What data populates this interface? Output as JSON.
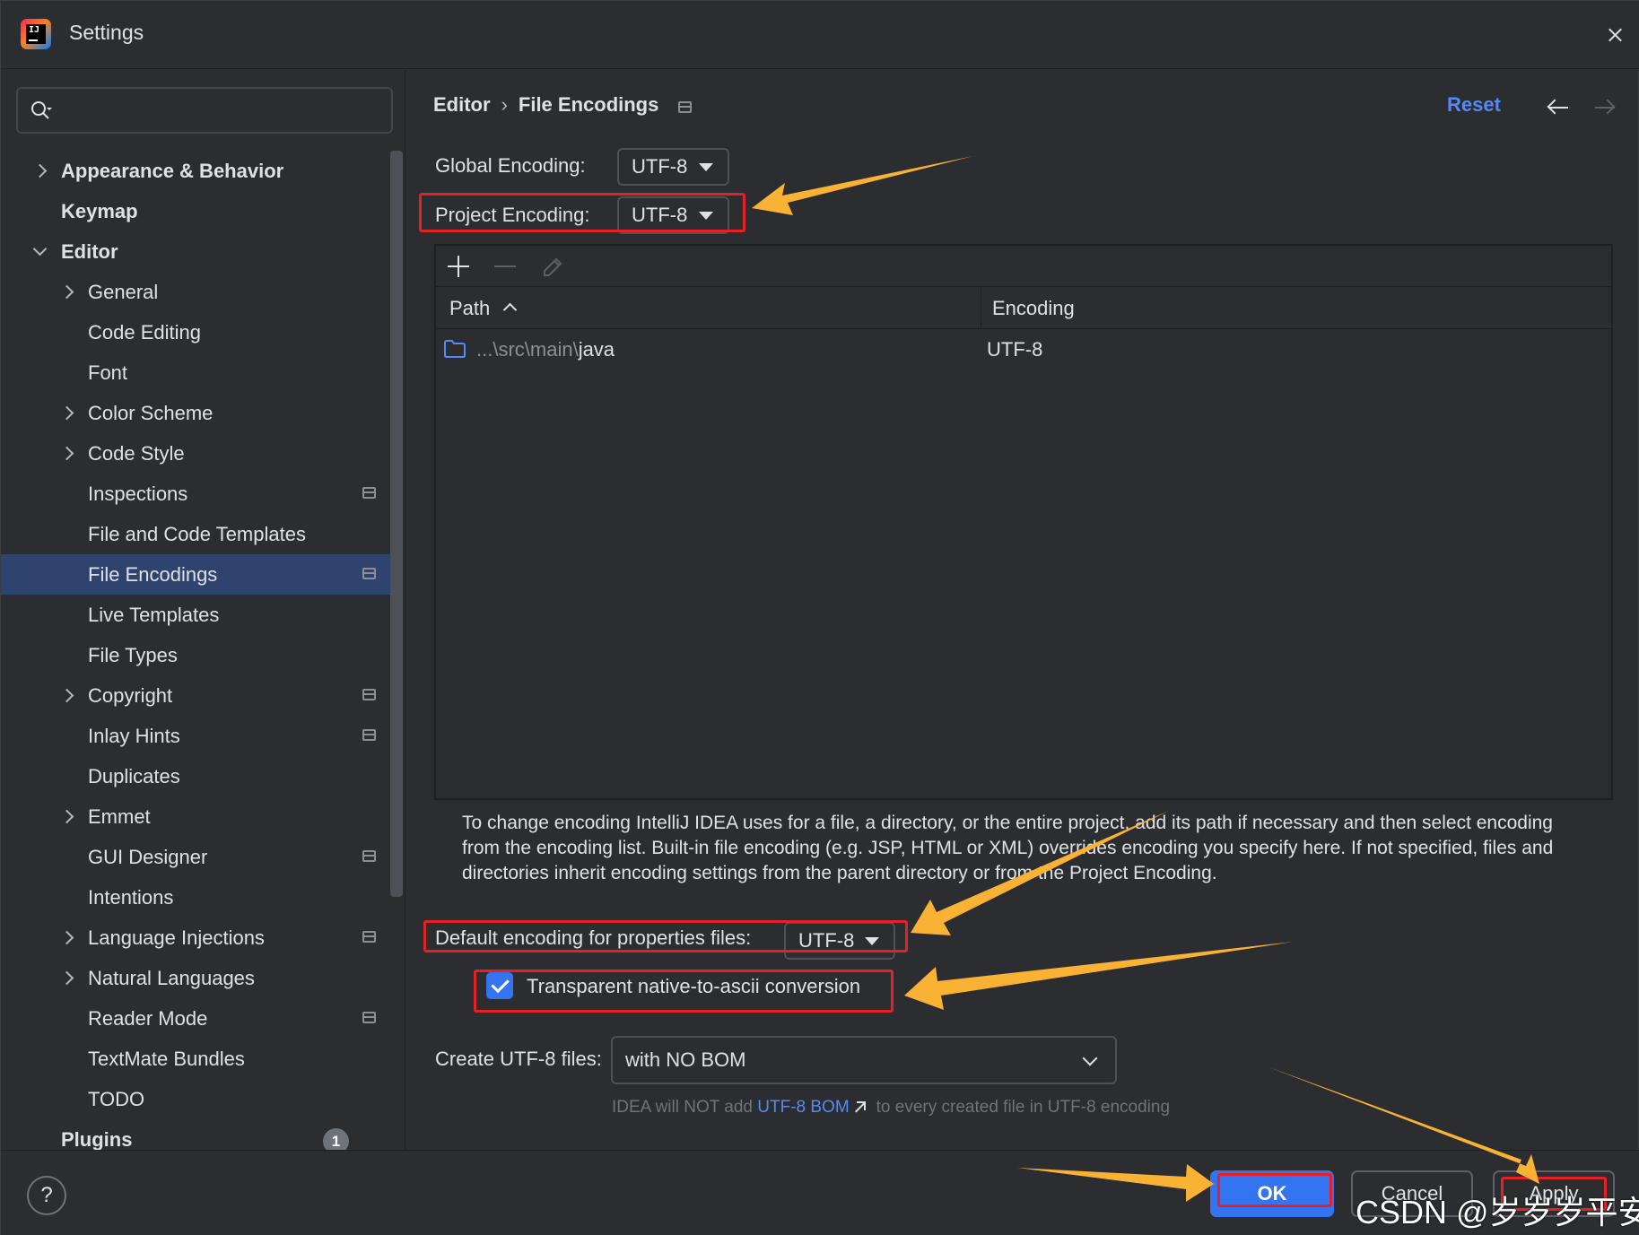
{
  "window": {
    "title": "Settings",
    "logo_text": "IJ"
  },
  "search": {
    "placeholder": "",
    "value": ""
  },
  "tree": [
    {
      "label": "Appearance & Behavior",
      "level": 0,
      "chevron": "closed",
      "bold": true,
      "project_icon": false
    },
    {
      "label": "Keymap",
      "level": 0,
      "chevron": "none",
      "bold": true,
      "project_icon": false
    },
    {
      "label": "Editor",
      "level": 0,
      "chevron": "open",
      "bold": true,
      "project_icon": false
    },
    {
      "label": "General",
      "level": 1,
      "chevron": "closed",
      "project_icon": false
    },
    {
      "label": "Code Editing",
      "level": 1,
      "chevron": "none",
      "project_icon": false
    },
    {
      "label": "Font",
      "level": 1,
      "chevron": "none",
      "project_icon": false
    },
    {
      "label": "Color Scheme",
      "level": 1,
      "chevron": "closed",
      "project_icon": false
    },
    {
      "label": "Code Style",
      "level": 1,
      "chevron": "closed",
      "project_icon": false
    },
    {
      "label": "Inspections",
      "level": 1,
      "chevron": "none",
      "project_icon": true
    },
    {
      "label": "File and Code Templates",
      "level": 1,
      "chevron": "none",
      "project_icon": false
    },
    {
      "label": "File Encodings",
      "level": 1,
      "chevron": "none",
      "project_icon": true,
      "selected": true
    },
    {
      "label": "Live Templates",
      "level": 1,
      "chevron": "none",
      "project_icon": false
    },
    {
      "label": "File Types",
      "level": 1,
      "chevron": "none",
      "project_icon": false
    },
    {
      "label": "Copyright",
      "level": 1,
      "chevron": "closed",
      "project_icon": true
    },
    {
      "label": "Inlay Hints",
      "level": 1,
      "chevron": "none",
      "project_icon": true
    },
    {
      "label": "Duplicates",
      "level": 1,
      "chevron": "none",
      "project_icon": false
    },
    {
      "label": "Emmet",
      "level": 1,
      "chevron": "closed",
      "project_icon": false
    },
    {
      "label": "GUI Designer",
      "level": 1,
      "chevron": "none",
      "project_icon": true
    },
    {
      "label": "Intentions",
      "level": 1,
      "chevron": "none",
      "project_icon": false
    },
    {
      "label": "Language Injections",
      "level": 1,
      "chevron": "closed",
      "project_icon": true
    },
    {
      "label": "Natural Languages",
      "level": 1,
      "chevron": "closed",
      "project_icon": false
    },
    {
      "label": "Reader Mode",
      "level": 1,
      "chevron": "none",
      "project_icon": true
    },
    {
      "label": "TextMate Bundles",
      "level": 1,
      "chevron": "none",
      "project_icon": false
    },
    {
      "label": "TODO",
      "level": 1,
      "chevron": "none",
      "project_icon": false
    },
    {
      "label": "Plugins",
      "level": 0,
      "chevron": "none",
      "bold": true,
      "project_icon": false,
      "badge": "1"
    }
  ],
  "breadcrumb": {
    "parent": "Editor",
    "separator": "›",
    "current": "File Encodings"
  },
  "header": {
    "reset_label": "Reset"
  },
  "global_encoding": {
    "label": "Global Encoding:",
    "value": "UTF-8"
  },
  "project_encoding": {
    "label": "Project Encoding:",
    "value": "UTF-8"
  },
  "table": {
    "columns": [
      "Path",
      "Encoding"
    ],
    "rows": [
      {
        "path_prefix": "...\\src\\main\\",
        "path_name": "java",
        "encoding": "UTF-8"
      }
    ]
  },
  "description": "To change encoding IntelliJ IDEA uses for a file, a directory, or the entire project, add its path if necessary and then select encoding from the encoding list. Built-in file encoding (e.g. JSP, HTML or XML) overrides encoding you specify here. If not specified, files and directories inherit encoding settings from the parent directory or from the Project Encoding.",
  "properties_encoding": {
    "label": "Default encoding for properties files:",
    "value": "UTF-8"
  },
  "transparent_conversion": {
    "label": "Transparent native-to-ascii conversion",
    "checked": true
  },
  "create_utf8": {
    "label": "Create UTF-8 files:",
    "value": "with NO BOM",
    "note_prefix": "IDEA will NOT add",
    "note_link": "UTF-8 BOM",
    "note_suffix": "to every created file in UTF-8 encoding"
  },
  "footer": {
    "help_label": "?",
    "ok_label": "OK",
    "cancel_label": "Cancel",
    "apply_label": "Apply"
  },
  "watermark": "CSDN @岁岁岁平安",
  "colors": {
    "accent": "#3574f0",
    "link": "#548af7",
    "annotation_red": "#e52126",
    "annotation_arrow": "#f9b233",
    "selection": "#2e436e",
    "background": "#2b2d30"
  }
}
